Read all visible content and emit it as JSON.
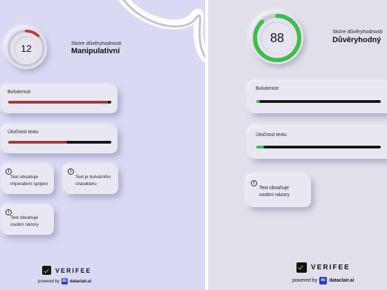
{
  "left": {
    "score": {
      "value": "12",
      "fraction": 0.12,
      "color": "#c0393d",
      "label": "Skóre důvěryhodnosti",
      "verdict": "Manipulativní"
    },
    "metrics": [
      {
        "label": "Bulvárnost",
        "fraction": 0.97,
        "color": "#a3383b"
      },
      {
        "label": "Útočnost textu",
        "fraction": 0.57,
        "color": "#a3383b"
      }
    ],
    "flags": [
      {
        "icon": "!",
        "text": "Text obsahuje\nimperativní spojení"
      },
      {
        "icon": "!",
        "text": "Text je bulvárního\ncharakteru"
      },
      {
        "icon": "!",
        "text": "Text obsahuje\nosobní názory"
      }
    ],
    "brand": {
      "name": "VERIFEE",
      "powered_by": "powered by",
      "partner": "dataclair.ai",
      "partner_icon": "dc"
    }
  },
  "right": {
    "score": {
      "value": "88",
      "fraction": 0.88,
      "color": "#3cbf4a",
      "label": "Skóre důvěryhodnosti",
      "verdict": "Důvěryhodný"
    },
    "metrics": [
      {
        "label": "Bulvárnost",
        "fraction": 0.03,
        "color": "#3cbf4a"
      },
      {
        "label": "Útočnost textu",
        "fraction": 0.06,
        "color": "#3cbf4a"
      }
    ],
    "flags": [
      {
        "icon": "!",
        "text": "Text obsahuje\nosobní názory"
      }
    ],
    "brand": {
      "name": "VERIFEE",
      "powered_by": "powered by",
      "partner": "dataclair.ai",
      "partner_icon": "dc"
    }
  }
}
